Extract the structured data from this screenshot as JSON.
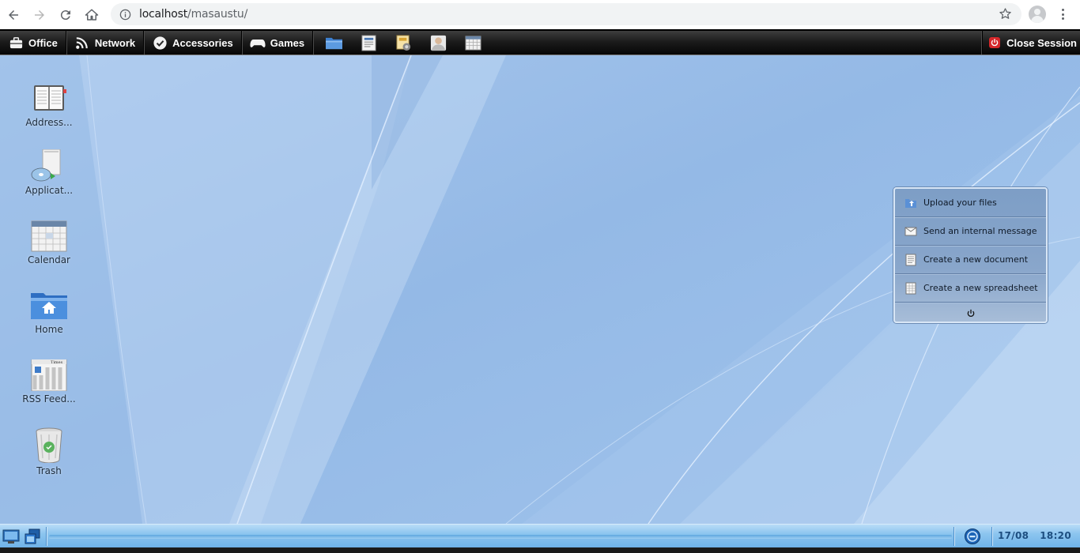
{
  "browser": {
    "url_host": "localhost",
    "url_path": "/masaustu/"
  },
  "menubar": {
    "items": [
      {
        "label": "Office",
        "icon": "briefcase-icon"
      },
      {
        "label": "Network",
        "icon": "rss-icon"
      },
      {
        "label": "Accessories",
        "icon": "check-circle-icon"
      },
      {
        "label": "Games",
        "icon": "gamepad-icon"
      }
    ],
    "quick_launch": [
      "folder-icon",
      "document-icon",
      "mail-icon",
      "user-icon",
      "calendar-icon"
    ],
    "close_session_label": "Close Session"
  },
  "desktop": {
    "icons": [
      {
        "label": "Address...",
        "icon": "address-book-icon"
      },
      {
        "label": "Applicat...",
        "icon": "applications-icon"
      },
      {
        "label": "Calendar",
        "icon": "calendar-icon"
      },
      {
        "label": "Home",
        "icon": "home-folder-icon"
      },
      {
        "label": "RSS Feed...",
        "icon": "rss-feed-icon"
      },
      {
        "label": "Trash",
        "icon": "trash-icon"
      }
    ]
  },
  "widget": {
    "items": [
      {
        "label": "Upload your files",
        "icon": "upload-icon"
      },
      {
        "label": "Send an internal message",
        "icon": "envelope-icon"
      },
      {
        "label": "Create a new document",
        "icon": "new-document-icon"
      },
      {
        "label": "Create a new spreadsheet",
        "icon": "new-spreadsheet-icon"
      }
    ]
  },
  "taskbar": {
    "date": "17/08",
    "time": "18:20"
  },
  "colors": {
    "desktop_bg": "#8fb6e4",
    "menubar_bg": "#1c1c1c",
    "taskbar_bg": "#8cc5ef",
    "close_session_red": "#d6272a"
  }
}
